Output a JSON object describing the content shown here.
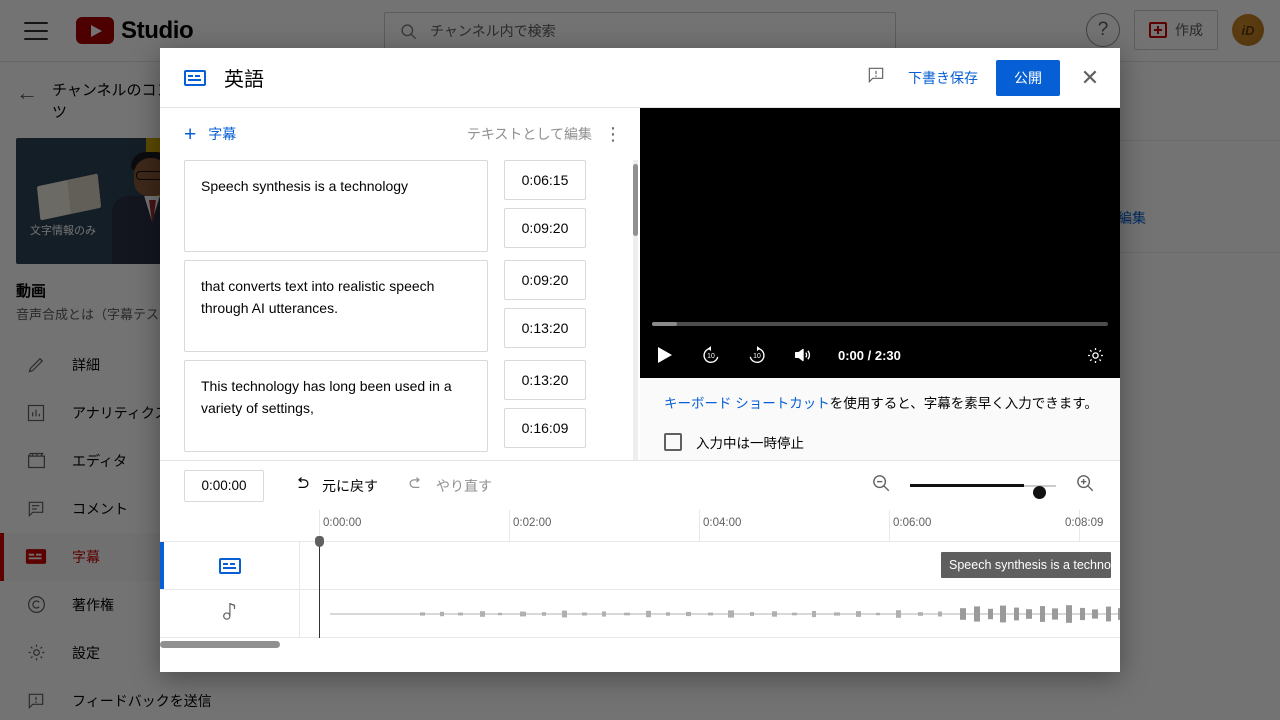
{
  "topbar": {
    "menu_icon": "hamburger-icon",
    "logo_text": "Studio",
    "search_placeholder": "チャンネル内で検索",
    "search_value": "",
    "help_icon": "question-mark-icon",
    "create_label": "作成",
    "avatar_initials": "iD"
  },
  "sidebar": {
    "back_icon": "back-arrow-icon",
    "title": "チャンネルのコンテンツ",
    "thumb_caption": "文字情報のみ",
    "video_section_label": "動画",
    "video_name": "音声合成とは（字幕テス",
    "edit_link": "編集",
    "items": [
      {
        "label": "詳細",
        "icon": "pencil-icon",
        "active": false
      },
      {
        "label": "アナリティクス",
        "icon": "bar-chart-icon",
        "active": false
      },
      {
        "label": "エディタ",
        "icon": "clapperboard-icon",
        "active": false
      },
      {
        "label": "コメント",
        "icon": "comment-icon",
        "active": false
      },
      {
        "label": "字幕",
        "icon": "closed-caption-icon",
        "active": true
      },
      {
        "label": "著作権",
        "icon": "copyright-icon",
        "active": false
      },
      {
        "label": "設定",
        "icon": "gear-icon",
        "active": false
      },
      {
        "label": "フィードバックを送信",
        "icon": "feedback-icon",
        "active": false
      }
    ]
  },
  "modal": {
    "header": {
      "icon": "closed-caption-icon",
      "title": "英語",
      "feedback_icon": "feedback-icon",
      "save_draft_label": "下書き保存",
      "publish_label": "公開",
      "close_icon": "close-icon"
    },
    "captions_toolbar": {
      "add_label": "字幕",
      "add_icon": "plus-icon",
      "edit_as_text_label": "テキストとして編集",
      "more_icon": "kebab-menu-icon"
    },
    "captions": [
      {
        "text": "Speech synthesis is a technology",
        "start": "0:06:15",
        "end": "0:09:20"
      },
      {
        "text": "that converts text into realistic speech through AI utterances.",
        "start": "0:09:20",
        "end": "0:13:20"
      },
      {
        "text": "This technology has long been used in a variety of settings,",
        "start": "0:13:20",
        "end": "0:16:09"
      }
    ],
    "player": {
      "play_icon": "play-icon",
      "rewind_label": "10",
      "forward_label": "10",
      "volume_icon": "volume-icon",
      "time_display": "0:00 / 2:30",
      "settings_icon": "gear-icon"
    },
    "hint": {
      "link_text": "キーボード ショートカット",
      "rest_text": "を使用すると、字幕を素早く入力できます。"
    },
    "pause_checkbox": {
      "label": "入力中は一時停止",
      "checked": false
    },
    "transport": {
      "current_time": "0:00:00",
      "undo_label": "元に戻す",
      "undo_icon": "undo-icon",
      "redo_label": "やり直す",
      "redo_icon": "redo-icon",
      "zoom_out_icon": "zoom-out-icon",
      "zoom_in_icon": "zoom-in-icon",
      "zoom_value": 80
    },
    "timeline": {
      "ticks": [
        "0:00:00",
        "0:02:00",
        "0:04:00",
        "0:06:00",
        "0:08:09"
      ],
      "tracks": [
        {
          "icon": "closed-caption-icon",
          "name": "caption-track",
          "selected": true
        },
        {
          "icon": "music-note-icon",
          "name": "audio-track",
          "selected": false
        }
      ],
      "cue_label": "Speech synthesis is a techno",
      "playhead_time": "0:00:00"
    }
  }
}
